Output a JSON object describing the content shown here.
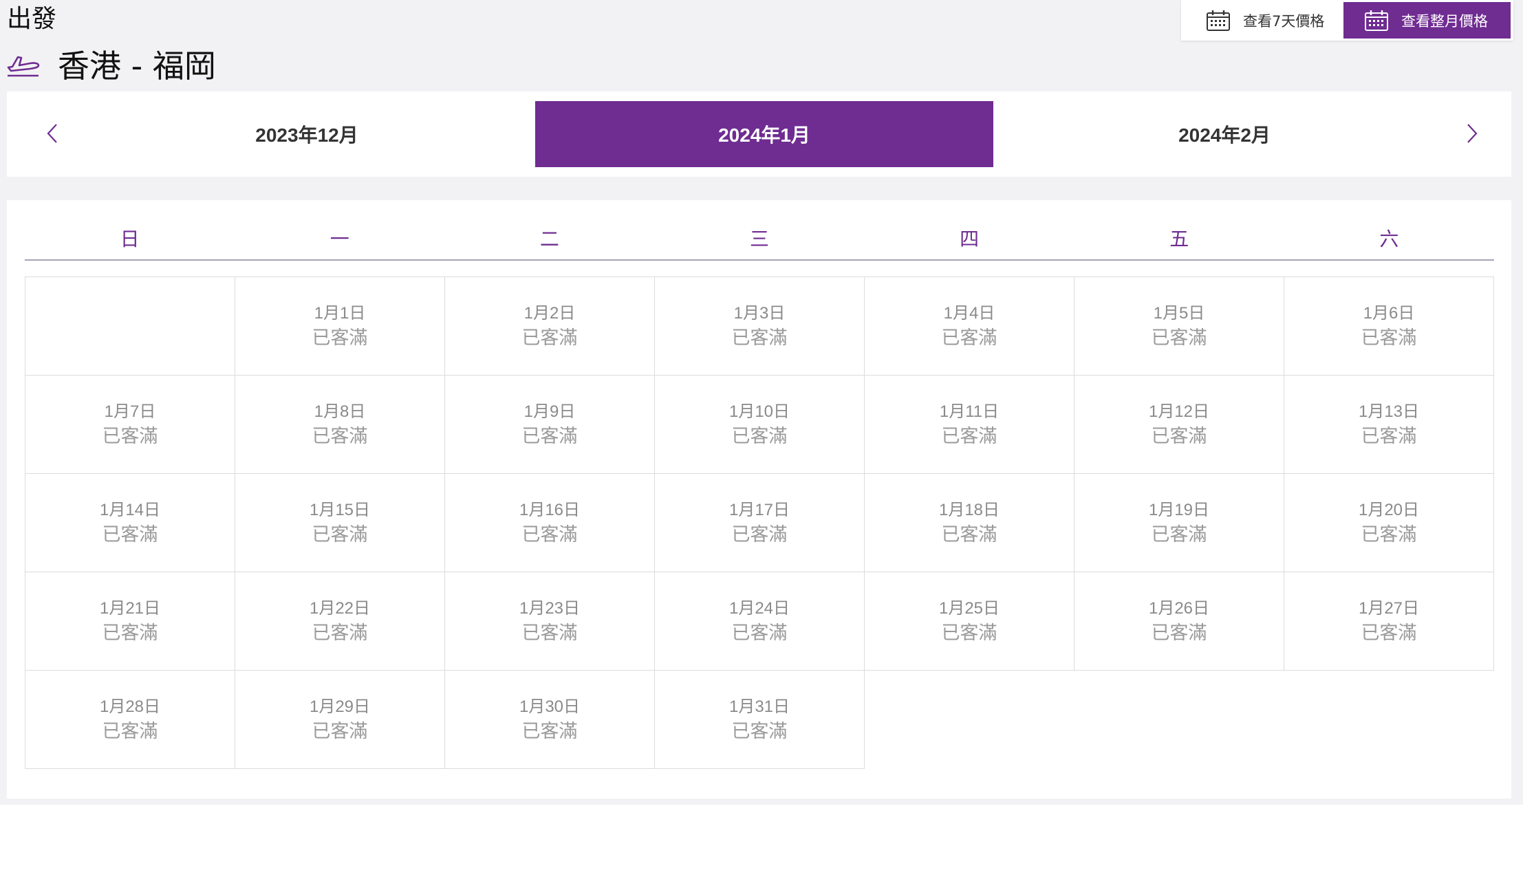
{
  "header": {
    "direction": "出發",
    "route": "香港 - 福岡"
  },
  "view_toggle": {
    "week_label": "查看7天價格",
    "month_label": "查看整月價格",
    "active": "month"
  },
  "months": {
    "tabs": [
      "2023年12月",
      "2024年1月",
      "2024年2月"
    ],
    "selected_index": 1
  },
  "calendar": {
    "weekdays": [
      "日",
      "一",
      "二",
      "三",
      "四",
      "五",
      "六"
    ],
    "days": [
      {
        "date": "1月1日",
        "status": "已客滿"
      },
      {
        "date": "1月2日",
        "status": "已客滿"
      },
      {
        "date": "1月3日",
        "status": "已客滿"
      },
      {
        "date": "1月4日",
        "status": "已客滿"
      },
      {
        "date": "1月5日",
        "status": "已客滿"
      },
      {
        "date": "1月6日",
        "status": "已客滿"
      },
      {
        "date": "1月7日",
        "status": "已客滿"
      },
      {
        "date": "1月8日",
        "status": "已客滿"
      },
      {
        "date": "1月9日",
        "status": "已客滿"
      },
      {
        "date": "1月10日",
        "status": "已客滿"
      },
      {
        "date": "1月11日",
        "status": "已客滿"
      },
      {
        "date": "1月12日",
        "status": "已客滿"
      },
      {
        "date": "1月13日",
        "status": "已客滿"
      },
      {
        "date": "1月14日",
        "status": "已客滿"
      },
      {
        "date": "1月15日",
        "status": "已客滿"
      },
      {
        "date": "1月16日",
        "status": "已客滿"
      },
      {
        "date": "1月17日",
        "status": "已客滿"
      },
      {
        "date": "1月18日",
        "status": "已客滿"
      },
      {
        "date": "1月19日",
        "status": "已客滿"
      },
      {
        "date": "1月20日",
        "status": "已客滿"
      },
      {
        "date": "1月21日",
        "status": "已客滿"
      },
      {
        "date": "1月22日",
        "status": "已客滿"
      },
      {
        "date": "1月23日",
        "status": "已客滿"
      },
      {
        "date": "1月24日",
        "status": "已客滿"
      },
      {
        "date": "1月25日",
        "status": "已客滿"
      },
      {
        "date": "1月26日",
        "status": "已客滿"
      },
      {
        "date": "1月27日",
        "status": "已客滿"
      },
      {
        "date": "1月28日",
        "status": "已客滿"
      },
      {
        "date": "1月29日",
        "status": "已客滿"
      },
      {
        "date": "1月30日",
        "status": "已客滿"
      },
      {
        "date": "1月31日",
        "status": "已客滿"
      }
    ]
  },
  "colors": {
    "brand_purple": "#6f2c91",
    "page_bg": "#f2f2f4",
    "muted_text": "#9a9a9a"
  },
  "icons": {
    "plane": "plane-takeoff-icon",
    "calendar": "calendar-icon",
    "prev": "chevron-left-icon",
    "next": "chevron-right-icon"
  }
}
